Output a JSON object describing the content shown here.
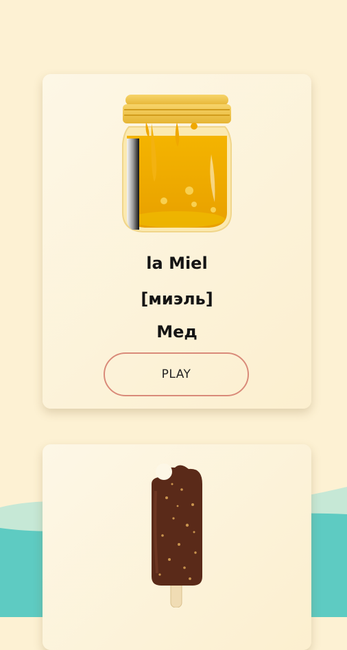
{
  "cards": [
    {
      "image_icon": "honey-jar-icon",
      "word": "la Miel",
      "transcription": "[миэль]",
      "translation": "Мед",
      "play_label": "PLAY"
    },
    {
      "image_icon": "chocolate-ice-cream-popsicle-icon"
    }
  ],
  "colors": {
    "background": "#fdf1d3",
    "button_border": "#d98a79",
    "wave_teal": "#5ecbc2",
    "wave_light": "#c6e8d6",
    "honey": "#f2b008"
  }
}
